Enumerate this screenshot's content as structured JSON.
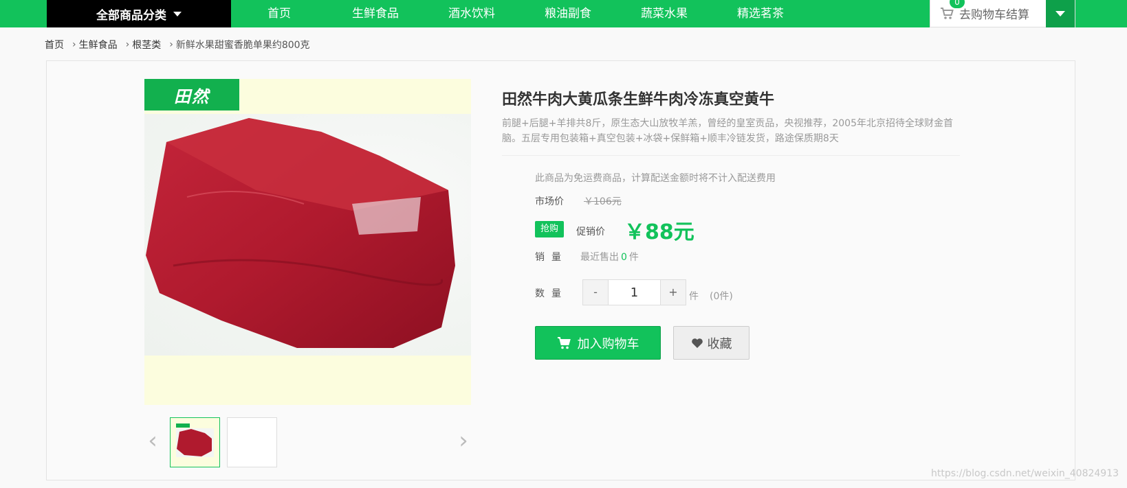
{
  "nav": {
    "all_categories": "全部商品分类",
    "links": [
      "首页",
      "生鲜食品",
      "酒水饮料",
      "粮油副食",
      "蔬菜水果",
      "精选茗茶"
    ],
    "cart_label": "去购物车结算",
    "cart_count": "0"
  },
  "breadcrumb": [
    "首页",
    "生鲜食品",
    "根茎类",
    "新鲜水果甜蜜香脆单果约800克"
  ],
  "gallery": {
    "brand_logo_text": "田然"
  },
  "product": {
    "title": "田然牛肉大黄瓜条生鲜牛肉冷冻真空黄牛",
    "subtitle": "前腿+后腿+羊排共8斤，原生态大山放牧羊羔，曾经的皇室贡品，央视推荐，2005年北京招待全球财金首脑。五层专用包装箱+真空包装+冰袋+保鲜箱+顺丰冷链发货，路途保质期8天",
    "free_shipping_note": "此商品为免运费商品，计算配送金额时将不计入配送费用",
    "market_price_label": "市场价",
    "market_price": "￥106元",
    "promo_badge": "抢购",
    "promo_label": "促销价",
    "promo_price": "￥88元",
    "sales_label": "销量",
    "sales_prefix": "最近售出",
    "sales_count": "0",
    "sales_unit": "件",
    "quantity_label": "数量",
    "quantity_value": "1",
    "quantity_minus": "-",
    "quantity_plus": "+",
    "quantity_unit": "件",
    "quantity_stock": "(0件)",
    "add_to_cart": "加入购物车",
    "favorite": "收藏"
  },
  "watermark": "https://blog.csdn.net/weixin_40824913",
  "colors": {
    "brand_green": "#12c25b",
    "nav_black": "#000000"
  }
}
